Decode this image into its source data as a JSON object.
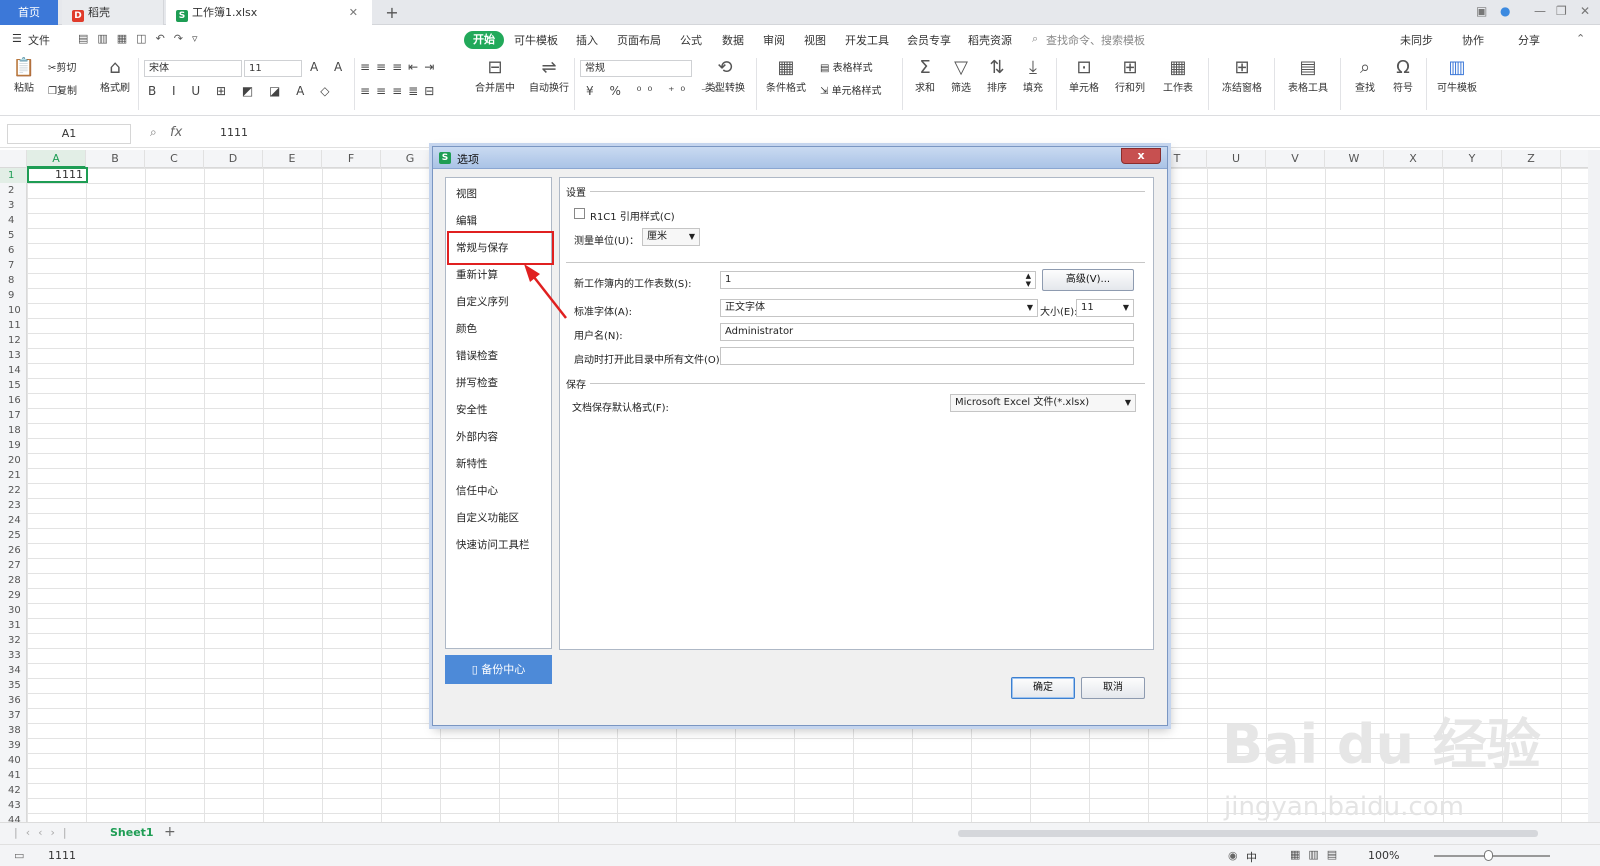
{
  "tabs": {
    "home": "首页",
    "docer": "稻壳",
    "workbook": "工作簿1.xlsx",
    "add": "+"
  },
  "menu": {
    "file": "文件",
    "items": [
      "开始",
      "可牛模板",
      "插入",
      "页面布局",
      "公式",
      "数据",
      "审阅",
      "视图",
      "开发工具",
      "会员专享",
      "稻壳资源"
    ],
    "search": "查找命令、搜索模板",
    "sync": "未同步",
    "collab": "协作",
    "share": "分享"
  },
  "ribbon": {
    "paste": "粘贴",
    "cut": "剪切",
    "copy": "复制",
    "format_painter": "格式刷",
    "font": "宋体",
    "size": "11",
    "number_format": "常规",
    "merge": "合并居中",
    "wrap": "自动换行",
    "convert": "类型转换",
    "cond_format": "条件格式",
    "table_style": "表格样式",
    "cell_style": "单元格样式",
    "sum": "求和",
    "filter": "筛选",
    "sort": "排序",
    "fill": "填充",
    "cell": "单元格",
    "rowcol": "行和列",
    "sheet": "工作表",
    "freeze": "冻结窗格",
    "table_tools": "表格工具",
    "find": "查找",
    "symbol": "符号",
    "template": "可牛模板"
  },
  "formula": {
    "cell": "A1",
    "fx": "fx",
    "value": "1111"
  },
  "columns": [
    "A",
    "B",
    "C",
    "D",
    "E",
    "F",
    "G",
    "H",
    "I",
    "J",
    "K",
    "L",
    "M",
    "N",
    "O",
    "P",
    "Q",
    "R",
    "S",
    "T",
    "U",
    "V",
    "W",
    "X",
    "Y",
    "Z"
  ],
  "rows": [
    "1",
    "2",
    "3",
    "4",
    "5",
    "6",
    "7",
    "8",
    "9",
    "10",
    "11",
    "12",
    "13",
    "14",
    "15",
    "16",
    "17",
    "18",
    "19",
    "20",
    "21",
    "22",
    "23",
    "24",
    "25",
    "26",
    "27",
    "28",
    "29",
    "30",
    "31",
    "32",
    "33",
    "34",
    "35",
    "36",
    "37",
    "38",
    "39",
    "40",
    "41",
    "42",
    "43",
    "44"
  ],
  "cell_a1": "1111",
  "sheet_tab": "Sheet1",
  "status": {
    "value": "1111",
    "zoom": "100%",
    "input": "中"
  },
  "dialog": {
    "title": "选项",
    "close": "x",
    "nav": [
      "视图",
      "编辑",
      "常规与保存",
      "重新计算",
      "自定义序列",
      "颜色",
      "错误检查",
      "拼写检查",
      "安全性",
      "外部内容",
      "新特性",
      "信任中心",
      "自定义功能区",
      "快速访问工具栏"
    ],
    "backup": "备份中心",
    "settings_header": "设置",
    "r1c1": "R1C1 引用样式(C)",
    "unit_label": "测量单位(U)：",
    "unit_value": "厘米",
    "sheets_label": "新工作簿内的工作表数(S):",
    "sheets_value": "1",
    "advanced": "高级(V)...",
    "font_label": "标准字体(A):",
    "font_value": "正文字体",
    "size_label": "大小(E):",
    "size_value": "11",
    "user_label": "用户名(N):",
    "user_value": "Administrator",
    "startup_label": "启动时打开此目录中所有文件(O):",
    "startup_value": "",
    "save_header": "保存",
    "save_format_label": "文档保存默认格式(F):",
    "save_format_value": "Microsoft Excel 文件(*.xlsx)",
    "ok": "确定",
    "cancel": "取消"
  },
  "watermark": {
    "main": "Bai du 经验",
    "url": "jingyan.baidu.com"
  },
  "colors": {
    "accent": "#1e9d54",
    "tab_home": "#3c78d8",
    "highlight": "#e02020"
  }
}
